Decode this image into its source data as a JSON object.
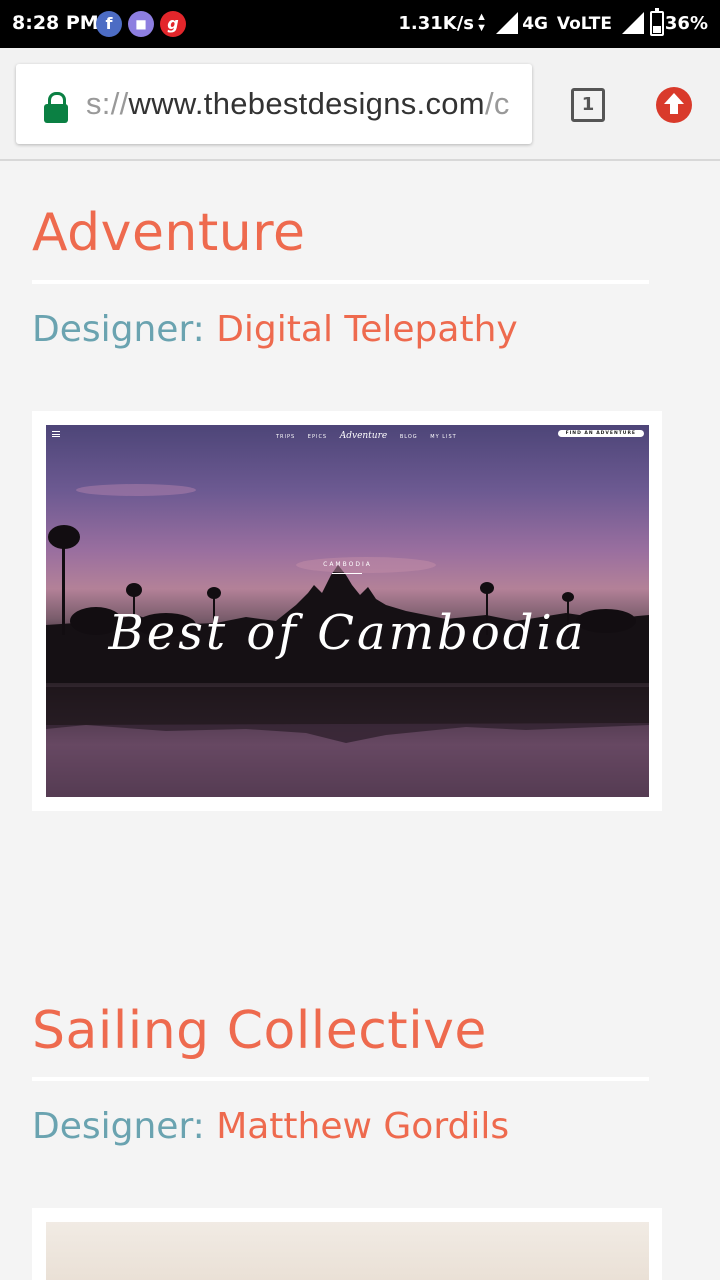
{
  "status_bar": {
    "time": "8:28 PM",
    "notif_icons": [
      "facebook-icon",
      "messenger-icon",
      "gaana-icon"
    ],
    "speed": "1.31K/s",
    "network": "4G",
    "volte": "VoLTE",
    "battery": "36%"
  },
  "browser": {
    "url_scheme": "s://",
    "url_host": "www.thebestdesigns.com",
    "url_tail": "/c",
    "tab_count": "1",
    "colors": {
      "lock": "#0b8043",
      "update": "#d93a2b"
    }
  },
  "cards": [
    {
      "title": "Adventure",
      "designer_label": "Designer: ",
      "designer_name": "Digital Telepathy",
      "preview": {
        "nav_links": [
          "TRIPS",
          "EPICS",
          "BLOG",
          "MY LIST"
        ],
        "logo": "Adventure",
        "cta": "FIND AN ADVENTURE",
        "country": "CAMBODIA",
        "headline": "Best of Cambodia"
      }
    },
    {
      "title": "Sailing Collective",
      "designer_label": "Designer: ",
      "designer_name": "Matthew Gordils"
    }
  ],
  "colors": {
    "accent": "#ee6a4e",
    "label": "#6aa3b0",
    "background": "#f4f4f4"
  }
}
